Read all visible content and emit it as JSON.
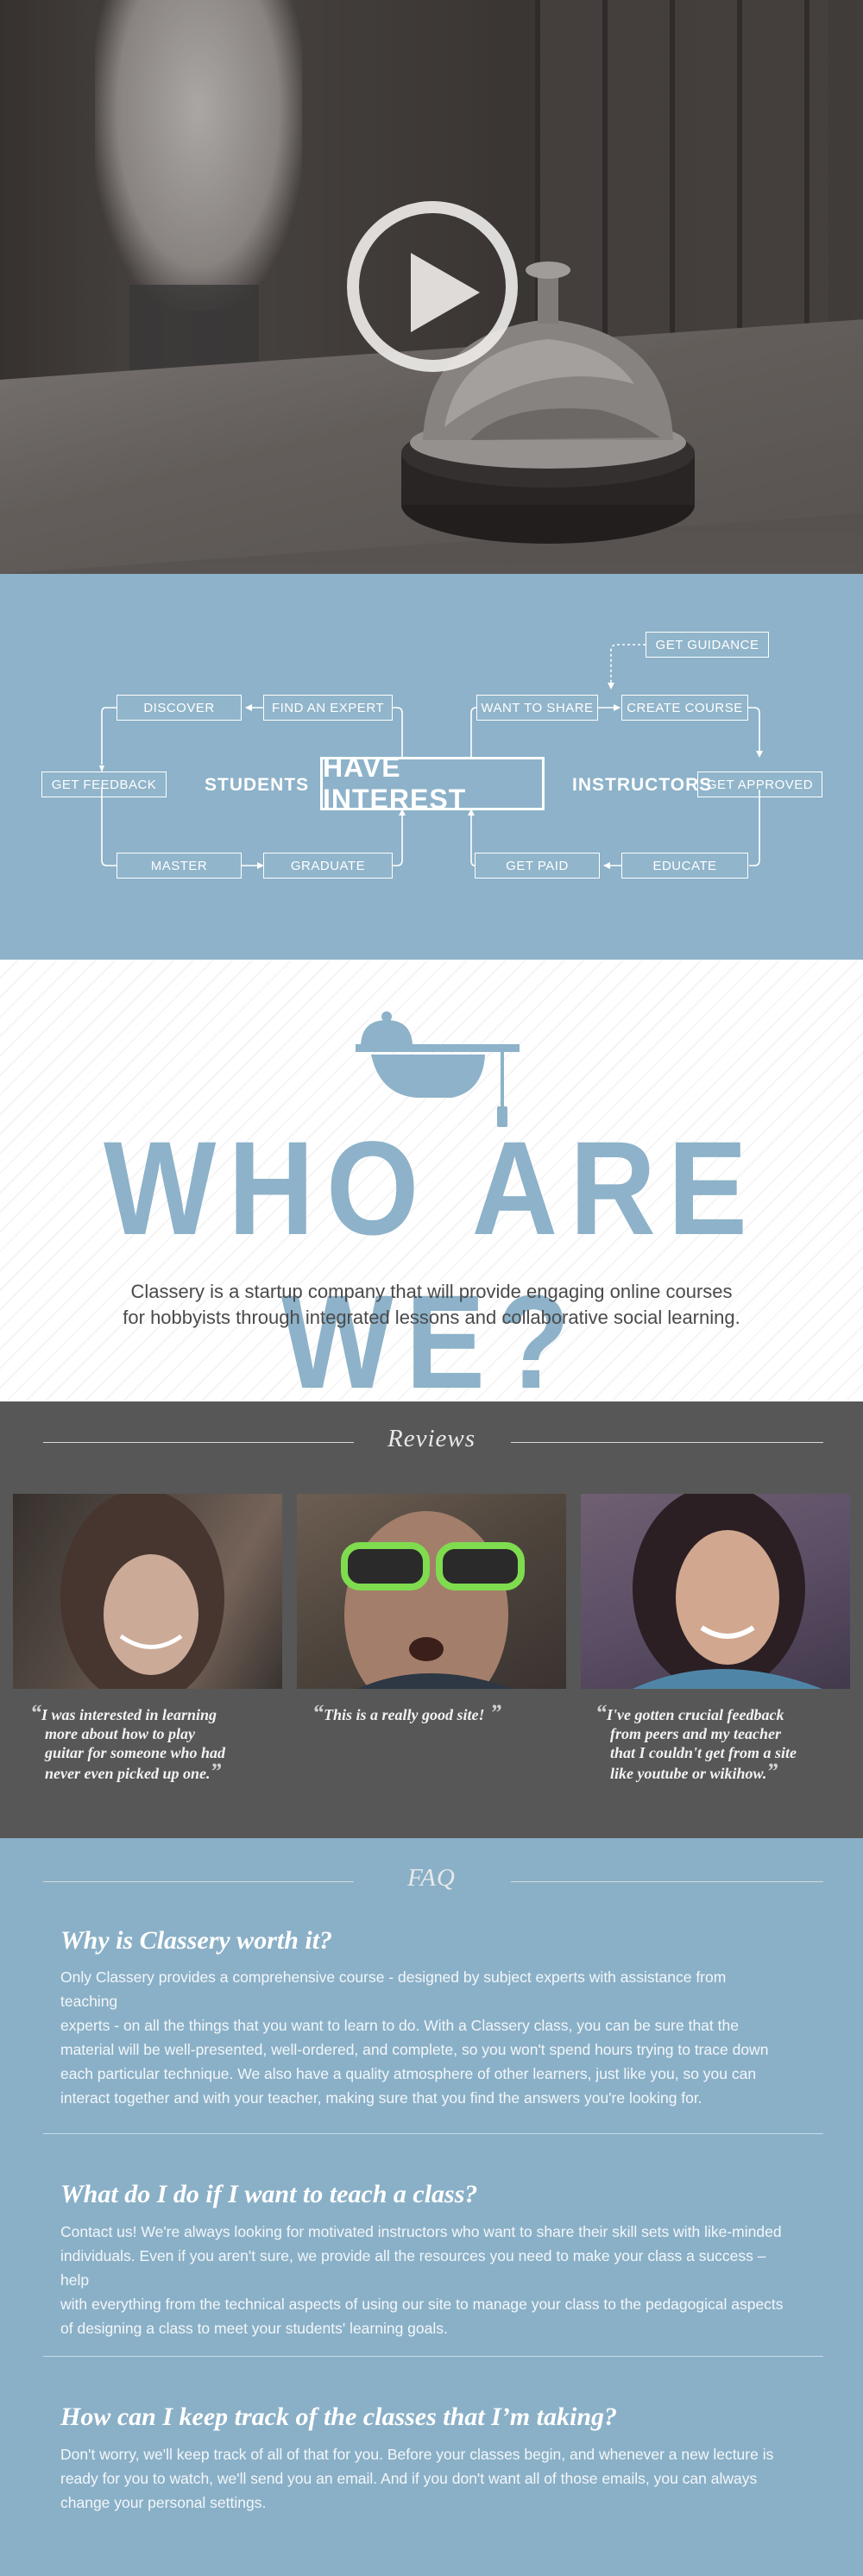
{
  "hero": {
    "play_icon": "play-icon"
  },
  "flow": {
    "center": "HAVE INTEREST",
    "students_label": "STUDENTS",
    "instructors_label": "INSTRUCTORS",
    "students_steps": {
      "discover": "DISCOVER",
      "find_expert": "FIND AN EXPERT",
      "get_feedback": "GET FEEDBACK",
      "master": "MASTER",
      "graduate": "GRADUATE"
    },
    "instructor_steps": {
      "get_guidance": "GET GUIDANCE",
      "want_to_share": "WANT TO SHARE",
      "create_course": "CREATE COURSE",
      "get_approved": "GET APPROVED",
      "get_paid": "GET PAID",
      "educate": "EDUCATE"
    }
  },
  "who": {
    "title": "WHO ARE WE?",
    "desc_line1": "Classery is a startup company that will provide engaging online courses",
    "desc_line2": "for hobbyists through integrated lessons and collaborative social learning."
  },
  "reviews": {
    "title": "Reviews",
    "items": [
      {
        "lines": [
          "I was interested in learning",
          "more about how to play",
          "guitar for someone who had",
          "never even picked up one."
        ]
      },
      {
        "lines": [
          "This is a really good site!"
        ]
      },
      {
        "lines": [
          "I've gotten crucial feedback",
          "from peers and my teacher",
          "that I couldn't get from a site",
          "like youtube or wikihow."
        ]
      }
    ]
  },
  "faq": {
    "title": "FAQ",
    "items": [
      {
        "q": "Why is Classery worth it?",
        "lines": [
          "Only Classery provides a comprehensive course - designed by subject experts with assistance from teaching",
          "experts - on all the things that you want to learn to do. With a Classery class, you can be sure that the",
          "material will be well-presented, well-ordered, and complete, so you won't spend hours trying to trace down",
          "each particular technique. We also have a quality atmosphere of other learners, just like you, so you can",
          "interact together and with your teacher, making sure that you find the answers you're looking for."
        ]
      },
      {
        "q": "What do I do if I want to teach a class?",
        "lines": [
          "Contact us! We're always looking for motivated instructors who want to share their skill sets with like-minded",
          "individuals. Even if you aren't sure, we provide all the resources you need to make your class a success – help",
          "with everything from the technical aspects of using our site to manage your class to the pedagogical aspects",
          "of designing a class to meet your students' learning goals."
        ]
      },
      {
        "q": "How can I keep track of the classes that I’m taking?",
        "lines": [
          "Don't worry, we'll keep track of all of that for you. Before your classes begin, and whenever a new lecture is",
          "ready for you to watch, we'll send you an email. And if you don't want all of those emails, you can always",
          "change your personal settings."
        ]
      }
    ]
  }
}
